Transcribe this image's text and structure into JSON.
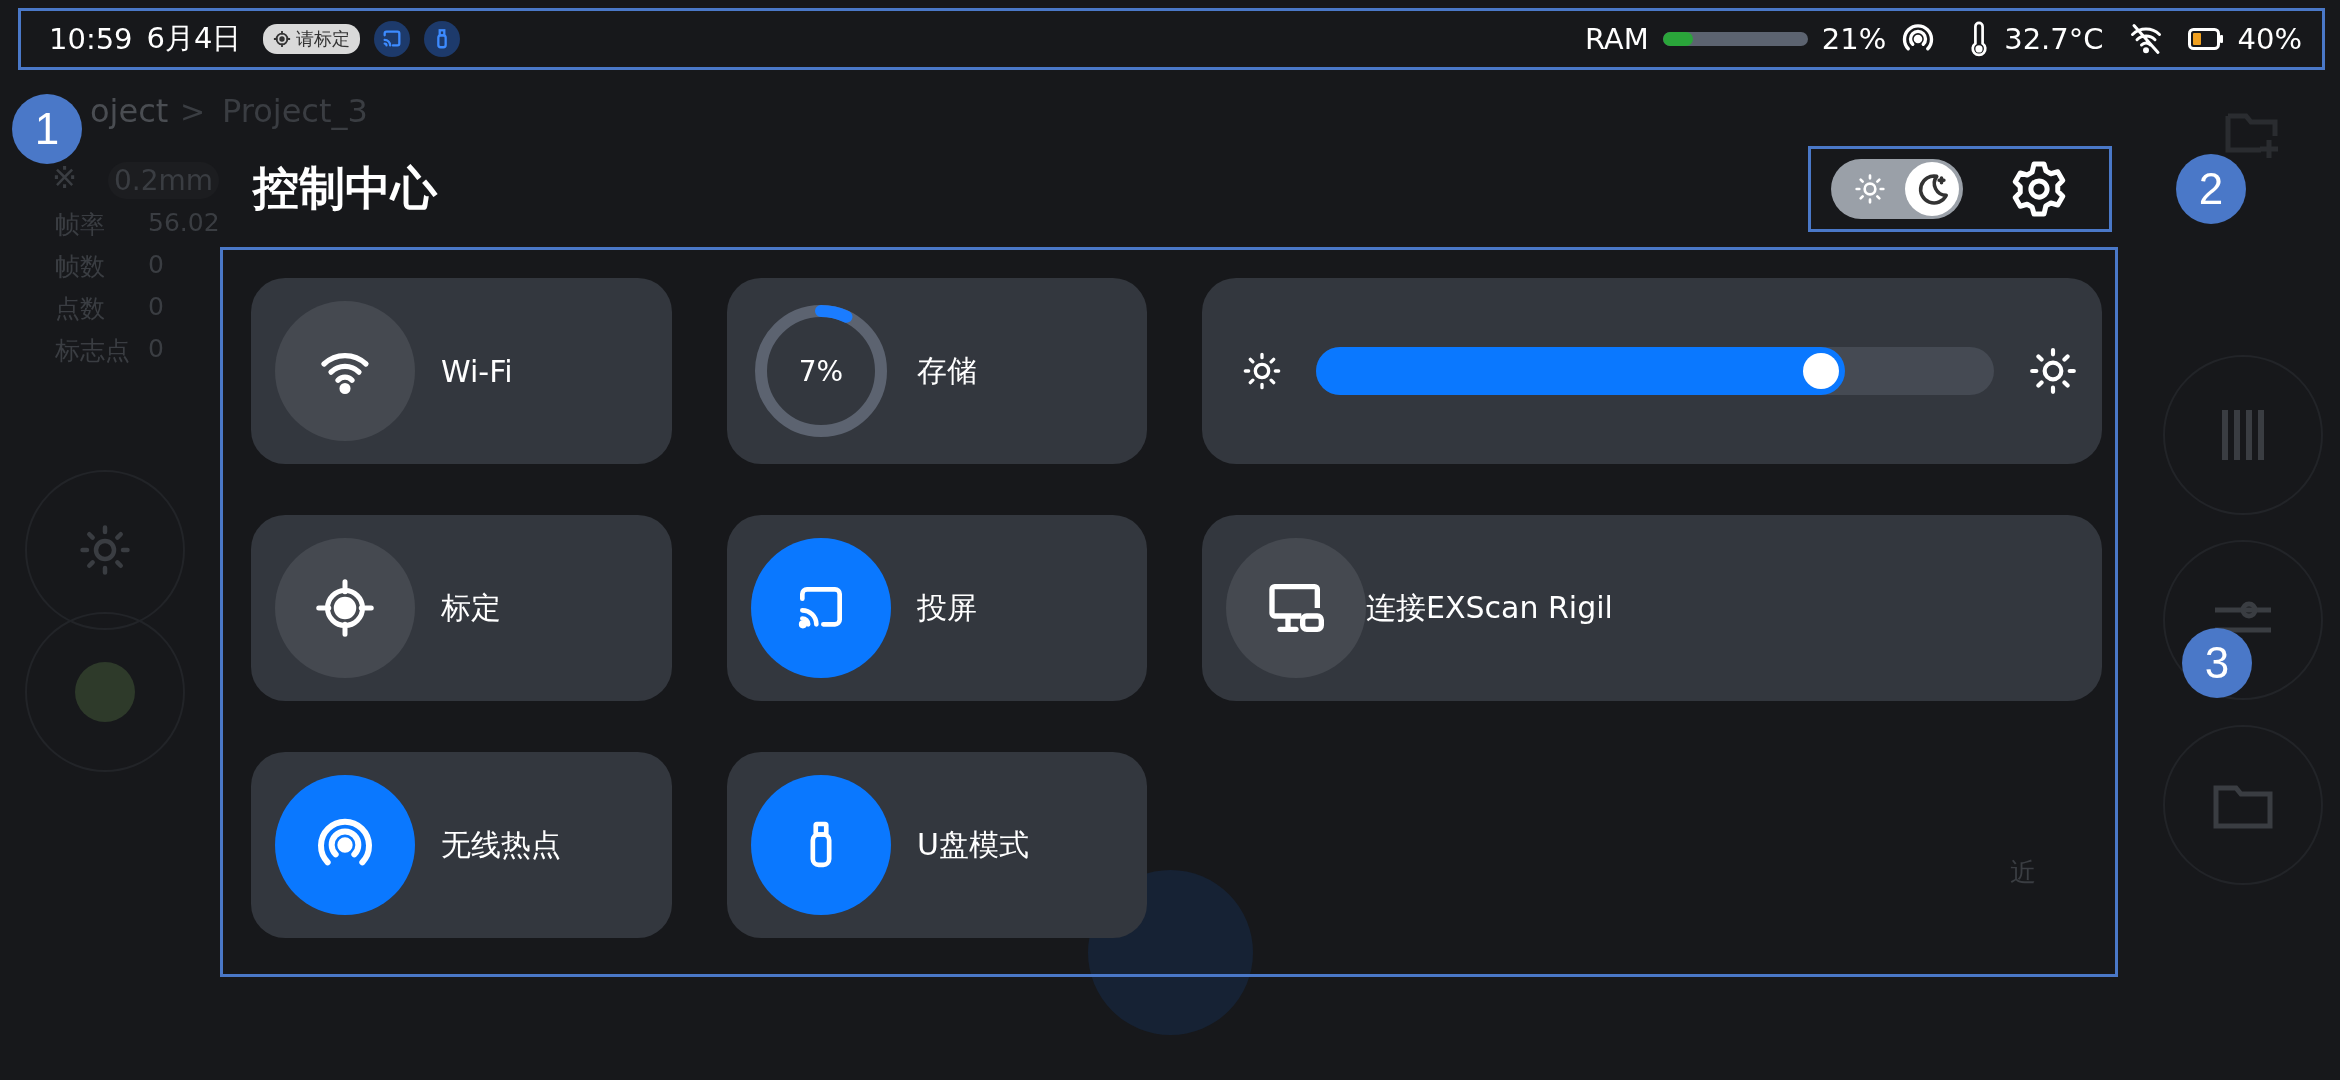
{
  "status_bar": {
    "time": "10:59",
    "date": "6月4日",
    "calibration_badge": "请标定",
    "cast_active": true,
    "usb_active": true,
    "ram_label": "RAM",
    "ram": {
      "level": 0.21
    },
    "ram_reading": "21%",
    "temperature": "32.7°C",
    "battery_reading": "40%"
  },
  "background": {
    "breadcrumb": [
      "oject",
      ">",
      "Project_3"
    ],
    "resolution_icon": "※",
    "resolution": "0.2mm",
    "stats": [
      {
        "label": "帧率",
        "value": "56.02"
      },
      {
        "label": "帧数",
        "value": "0"
      },
      {
        "label": "点数",
        "value": "0"
      },
      {
        "label": "标志点",
        "value": "0"
      }
    ],
    "distance_label": "近"
  },
  "control_center": {
    "title": "控制中心",
    "theme": {
      "dark": true
    },
    "tiles": [
      {
        "kind": "wifi",
        "label": "Wi-Fi",
        "on": false
      },
      {
        "kind": "storage",
        "label": "存储",
        "reading": "7%",
        "level": 0.07
      },
      {
        "kind": "brightness",
        "level": 0.78
      },
      {
        "kind": "calibration",
        "label": "标定",
        "on": false
      },
      {
        "kind": "cast",
        "label": "投屏",
        "on": true
      },
      {
        "kind": "device",
        "label": "连接EXScan Rigil",
        "on": false
      },
      {
        "kind": "hotspot",
        "label": "无线热点",
        "on": true
      },
      {
        "kind": "usb",
        "label": "U盘模式",
        "on": true
      }
    ]
  },
  "annotations": [
    "1",
    "2",
    "3"
  ]
}
